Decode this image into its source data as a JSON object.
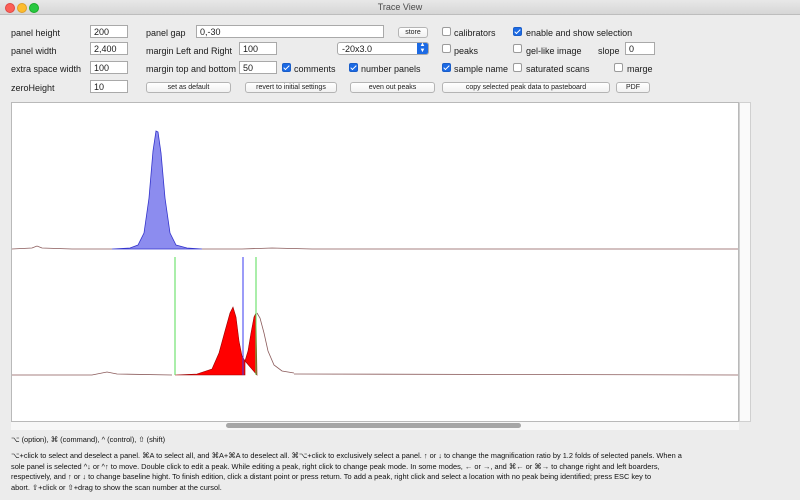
{
  "window": {
    "title": "Trace View"
  },
  "fields": {
    "panel_height": {
      "label": "panel height",
      "value": "200"
    },
    "panel_width": {
      "label": "panel width",
      "value": "2,400"
    },
    "extra_space_width": {
      "label": "extra space width",
      "value": "100"
    },
    "zero_height": {
      "label": "zeroHeight",
      "value": "10"
    },
    "panel_gap": {
      "label": "panel gap",
      "value": "0,-30"
    },
    "margin_left_right": {
      "label": "margin Left and Right",
      "value": "100"
    },
    "margin_top_bottom": {
      "label": "margin top and bottom",
      "value": "50"
    },
    "slope": {
      "label": "slope",
      "value": "0"
    }
  },
  "select": {
    "value": "-20x3.0"
  },
  "buttons": {
    "store": "store",
    "set_default": "set as default",
    "revert": "revert to initial settings",
    "even_out": "even out peaks",
    "copy_peak": "copy selected peak data to pasteboard",
    "pdf": "PDF"
  },
  "checkboxes": {
    "calibrators": {
      "label": "calibrators",
      "checked": false
    },
    "peaks": {
      "label": "peaks",
      "checked": false
    },
    "enable_show_selection": {
      "label": "enable and show selection",
      "checked": true
    },
    "gel_like_image": {
      "label": "gel-like image",
      "checked": false
    },
    "comments": {
      "label": "comments",
      "checked": true
    },
    "number_panels": {
      "label": "number panels",
      "checked": true
    },
    "sample_name": {
      "label": "sample name",
      "checked": true
    },
    "saturated_scans": {
      "label": "saturated scans",
      "checked": false
    },
    "marge": {
      "label": "marge",
      "checked": false
    }
  },
  "colors": {
    "panel1_fill": "#8c8cef",
    "panel2_fill": "#ff0000",
    "baseline": "#8a5a5a",
    "marker_green": "#55dd55",
    "marker_blue": "#3a3af0",
    "accent": "#1c6ae4"
  },
  "help": {
    "legend": "⌥ (option), ⌘ (command), ^ (control), ⇧ (shift)",
    "line1": "⌥+click to select and deselect a panel. ⌘A to select all, and ⌘A+⌘A to deselect all. ⌘⌥+click to exclusively select a panel. ↑ or ↓ to change the magnification ratio by 1.2 folds of selected panels. When a",
    "line2": "sole panel is selected ^↓ or ^↑ to move.  Double click to edit a peak. While editing a peak, right click to change peak mode.  In some modes, ← or →, and ⌘← or ⌘→ to change right and left boarders,",
    "line3": "respectively, and ↑ or ↓ to  change baseline hight. To finish edition, click a distant point or press return. To add a peak, right click and select a location with no peak being identified; press ESC key to",
    "line4": "abort. ⇧+click or ⇧+drag to show the scan number at the cursol."
  }
}
